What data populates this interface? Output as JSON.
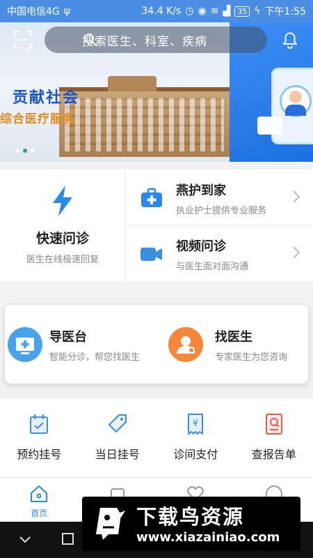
{
  "status_bar": {
    "carrier": "中国电信4G",
    "speed": "34.4 K/s",
    "battery": "35",
    "time": "下午1:55"
  },
  "banner": {
    "headline": "贡献社会",
    "subline": "综合医疗服务",
    "active_slide": 2,
    "slide_count": 3
  },
  "search": {
    "placeholder": "搜索医生、科室、疾病"
  },
  "services": {
    "quick": {
      "title": "快速问诊",
      "subtitle": "医生在线极速回复",
      "icon": "lightning-icon",
      "color": "#2b8ae8"
    },
    "home_care": {
      "title": "燕护到家",
      "subtitle": "执业护士提供专业服务",
      "icon": "medical-kit-icon"
    },
    "video": {
      "title": "视频问诊",
      "subtitle": "与医生面对面沟通",
      "icon": "video-camera-icon"
    }
  },
  "guide_card": {
    "guide": {
      "title": "导医台",
      "subtitle": "智能分诊，帮您找医生",
      "color": "#4aa2ea"
    },
    "find_doctor": {
      "title": "找医生",
      "subtitle": "专家医生为您咨询",
      "color": "#f4873a"
    }
  },
  "grid": [
    {
      "label": "预约挂号",
      "icon": "calendar-check-icon",
      "color": "#3a8fe0"
    },
    {
      "label": "当日挂号",
      "icon": "tag-icon",
      "color": "#3a8fe0"
    },
    {
      "label": "诊间支付",
      "icon": "receipt-yen-icon",
      "color": "#3a8fe0"
    },
    {
      "label": "查报告单",
      "icon": "report-search-icon",
      "color": "#e85a4a"
    }
  ],
  "bottom_nav": [
    {
      "label": "首页",
      "icon": "home-icon",
      "active": true
    },
    {
      "label": "",
      "icon": "nav-icon-2",
      "active": false
    },
    {
      "label": "",
      "icon": "heart-icon",
      "active": false
    },
    {
      "label": "",
      "icon": "profile-icon",
      "active": false
    }
  ],
  "watermark": {
    "title": "下载鸟资源",
    "url": "www.xiazainiao.com"
  }
}
